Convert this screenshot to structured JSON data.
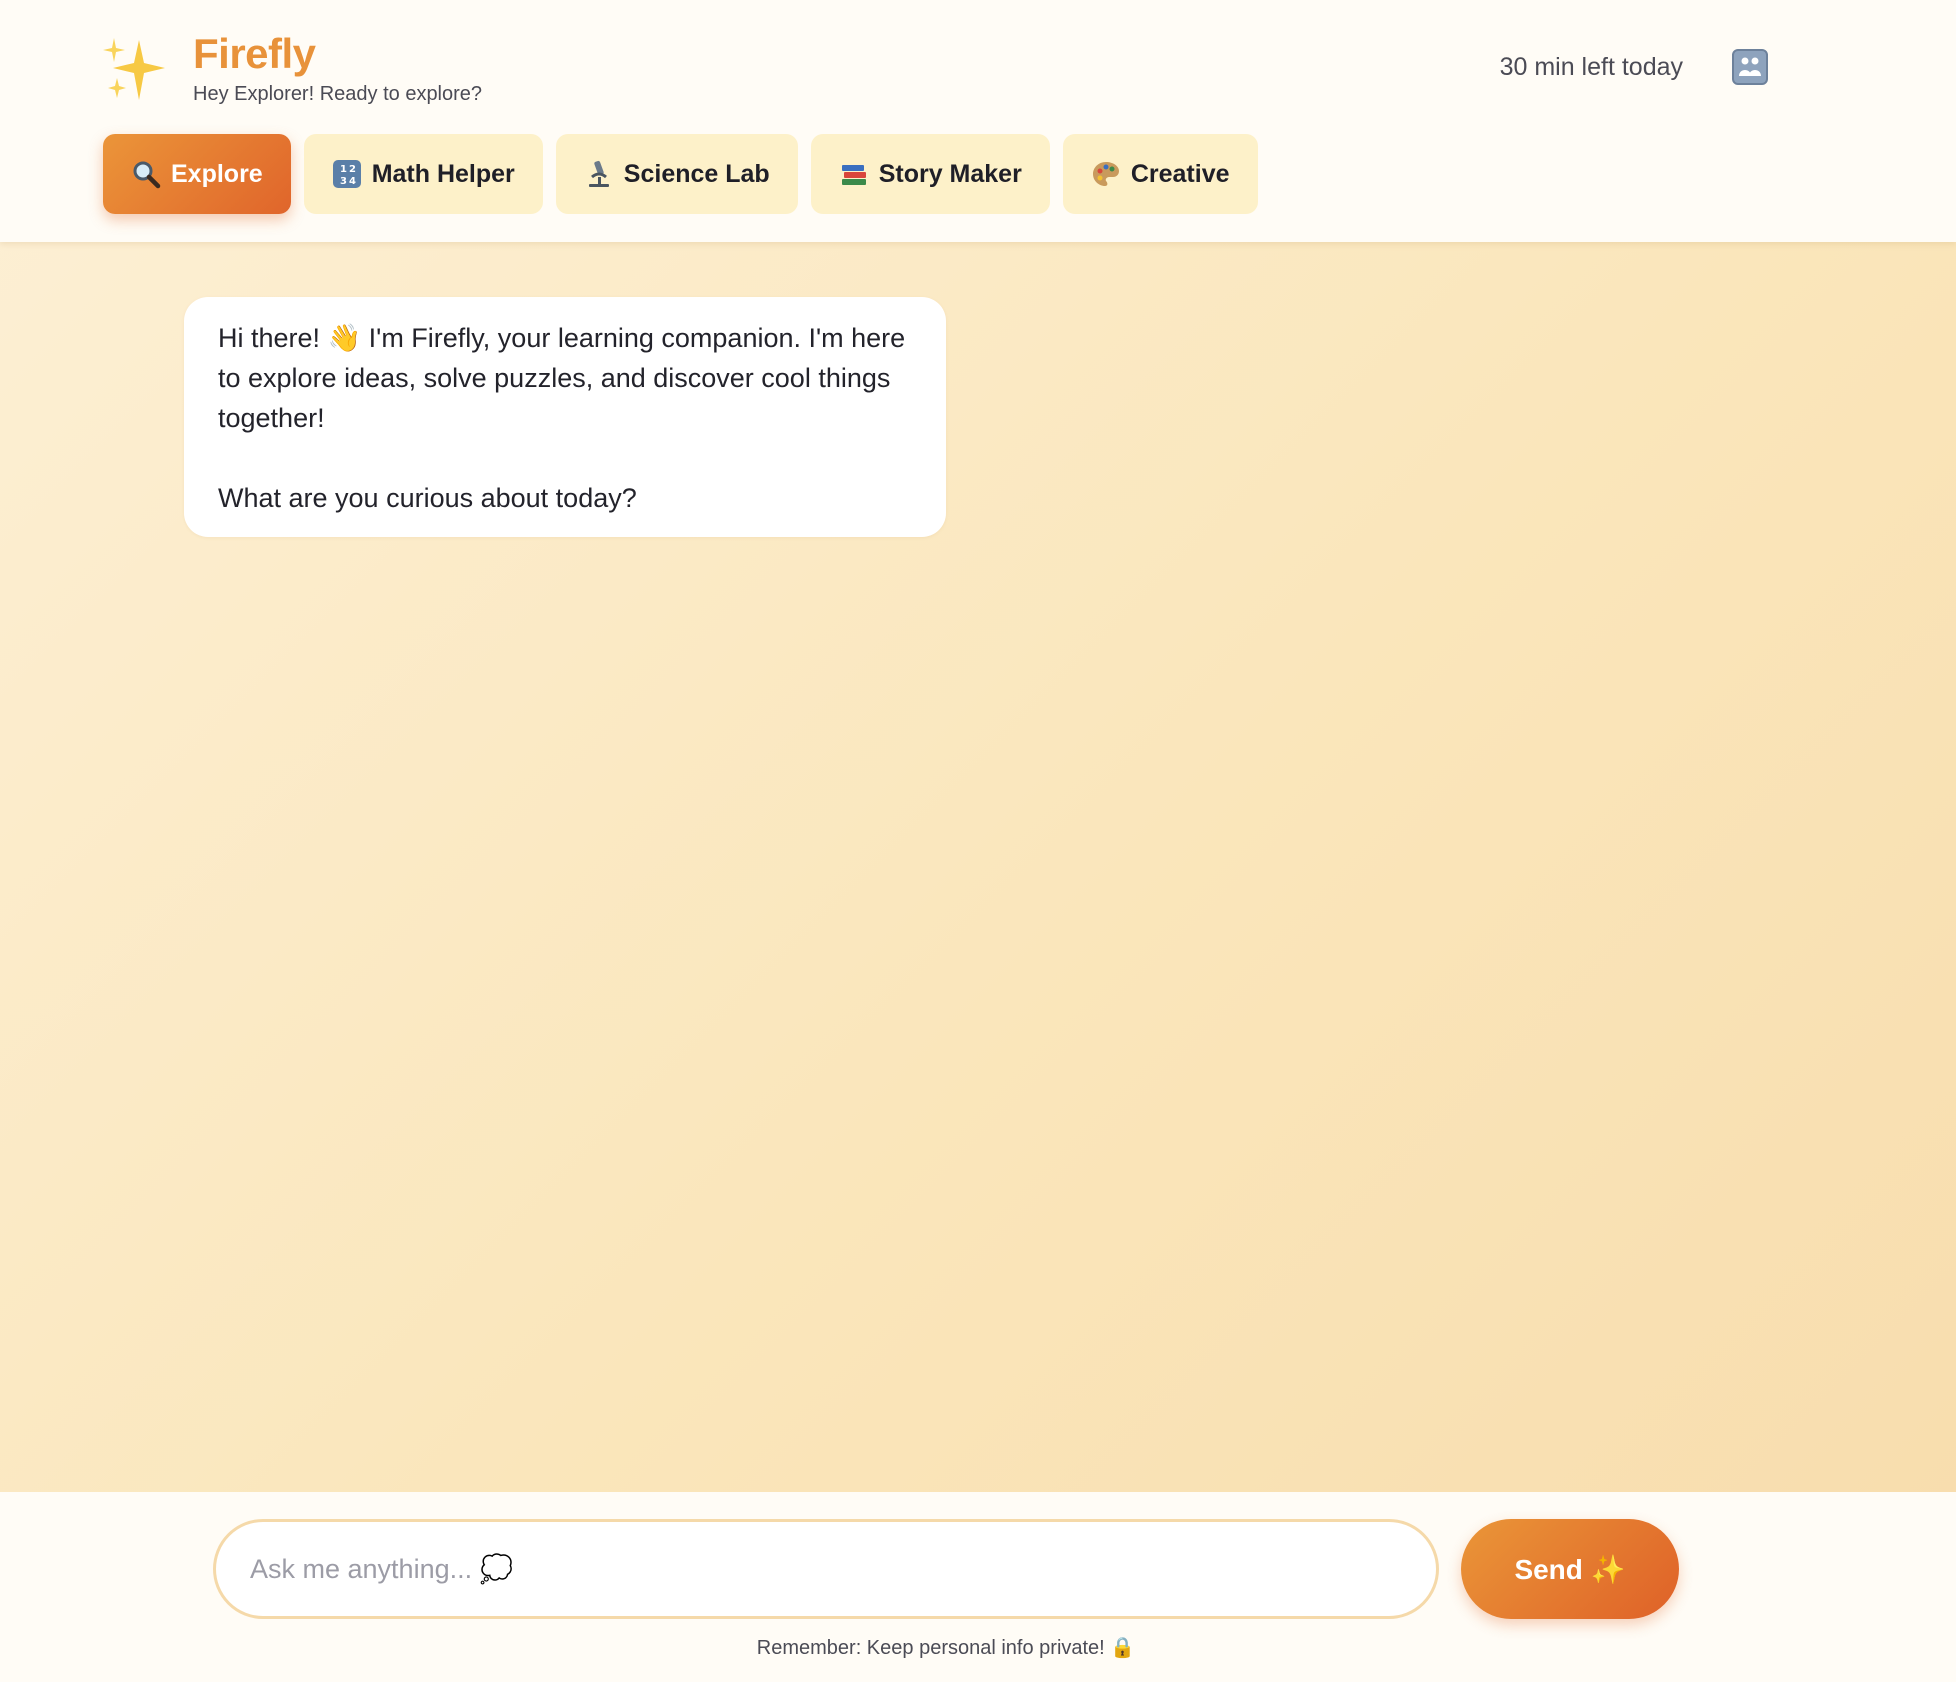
{
  "header": {
    "title": "Firefly",
    "subtitle": "Hey Explorer! Ready to explore?",
    "time_left": "30 min left today",
    "logo_icon": "sparkles-icon",
    "parent_icon": "family-icon"
  },
  "tabs": [
    {
      "label": "Explore",
      "icon": "magnifier-icon",
      "active": true
    },
    {
      "label": "Math Helper",
      "icon": "numbers-icon",
      "active": false
    },
    {
      "label": "Science Lab",
      "icon": "microscope-icon",
      "active": false
    },
    {
      "label": "Story Maker",
      "icon": "books-icon",
      "active": false
    },
    {
      "label": "Creative",
      "icon": "palette-icon",
      "active": false
    }
  ],
  "chat": {
    "welcome_line1": "Hi there! 👋 I'm Firefly, your learning companion. I'm here to explore ideas, solve puzzles, and discover cool things together!",
    "welcome_line2": "What are you curious about today?"
  },
  "composer": {
    "placeholder": "Ask me anything... 💭",
    "send_label": "Send ✨",
    "privacy_note": "Remember: Keep personal info private! 🔒"
  },
  "colors": {
    "accent": "#e8923a",
    "accent_dark": "#df6128",
    "tab_bg": "#fdf1c9",
    "background": "#fae6bb"
  }
}
